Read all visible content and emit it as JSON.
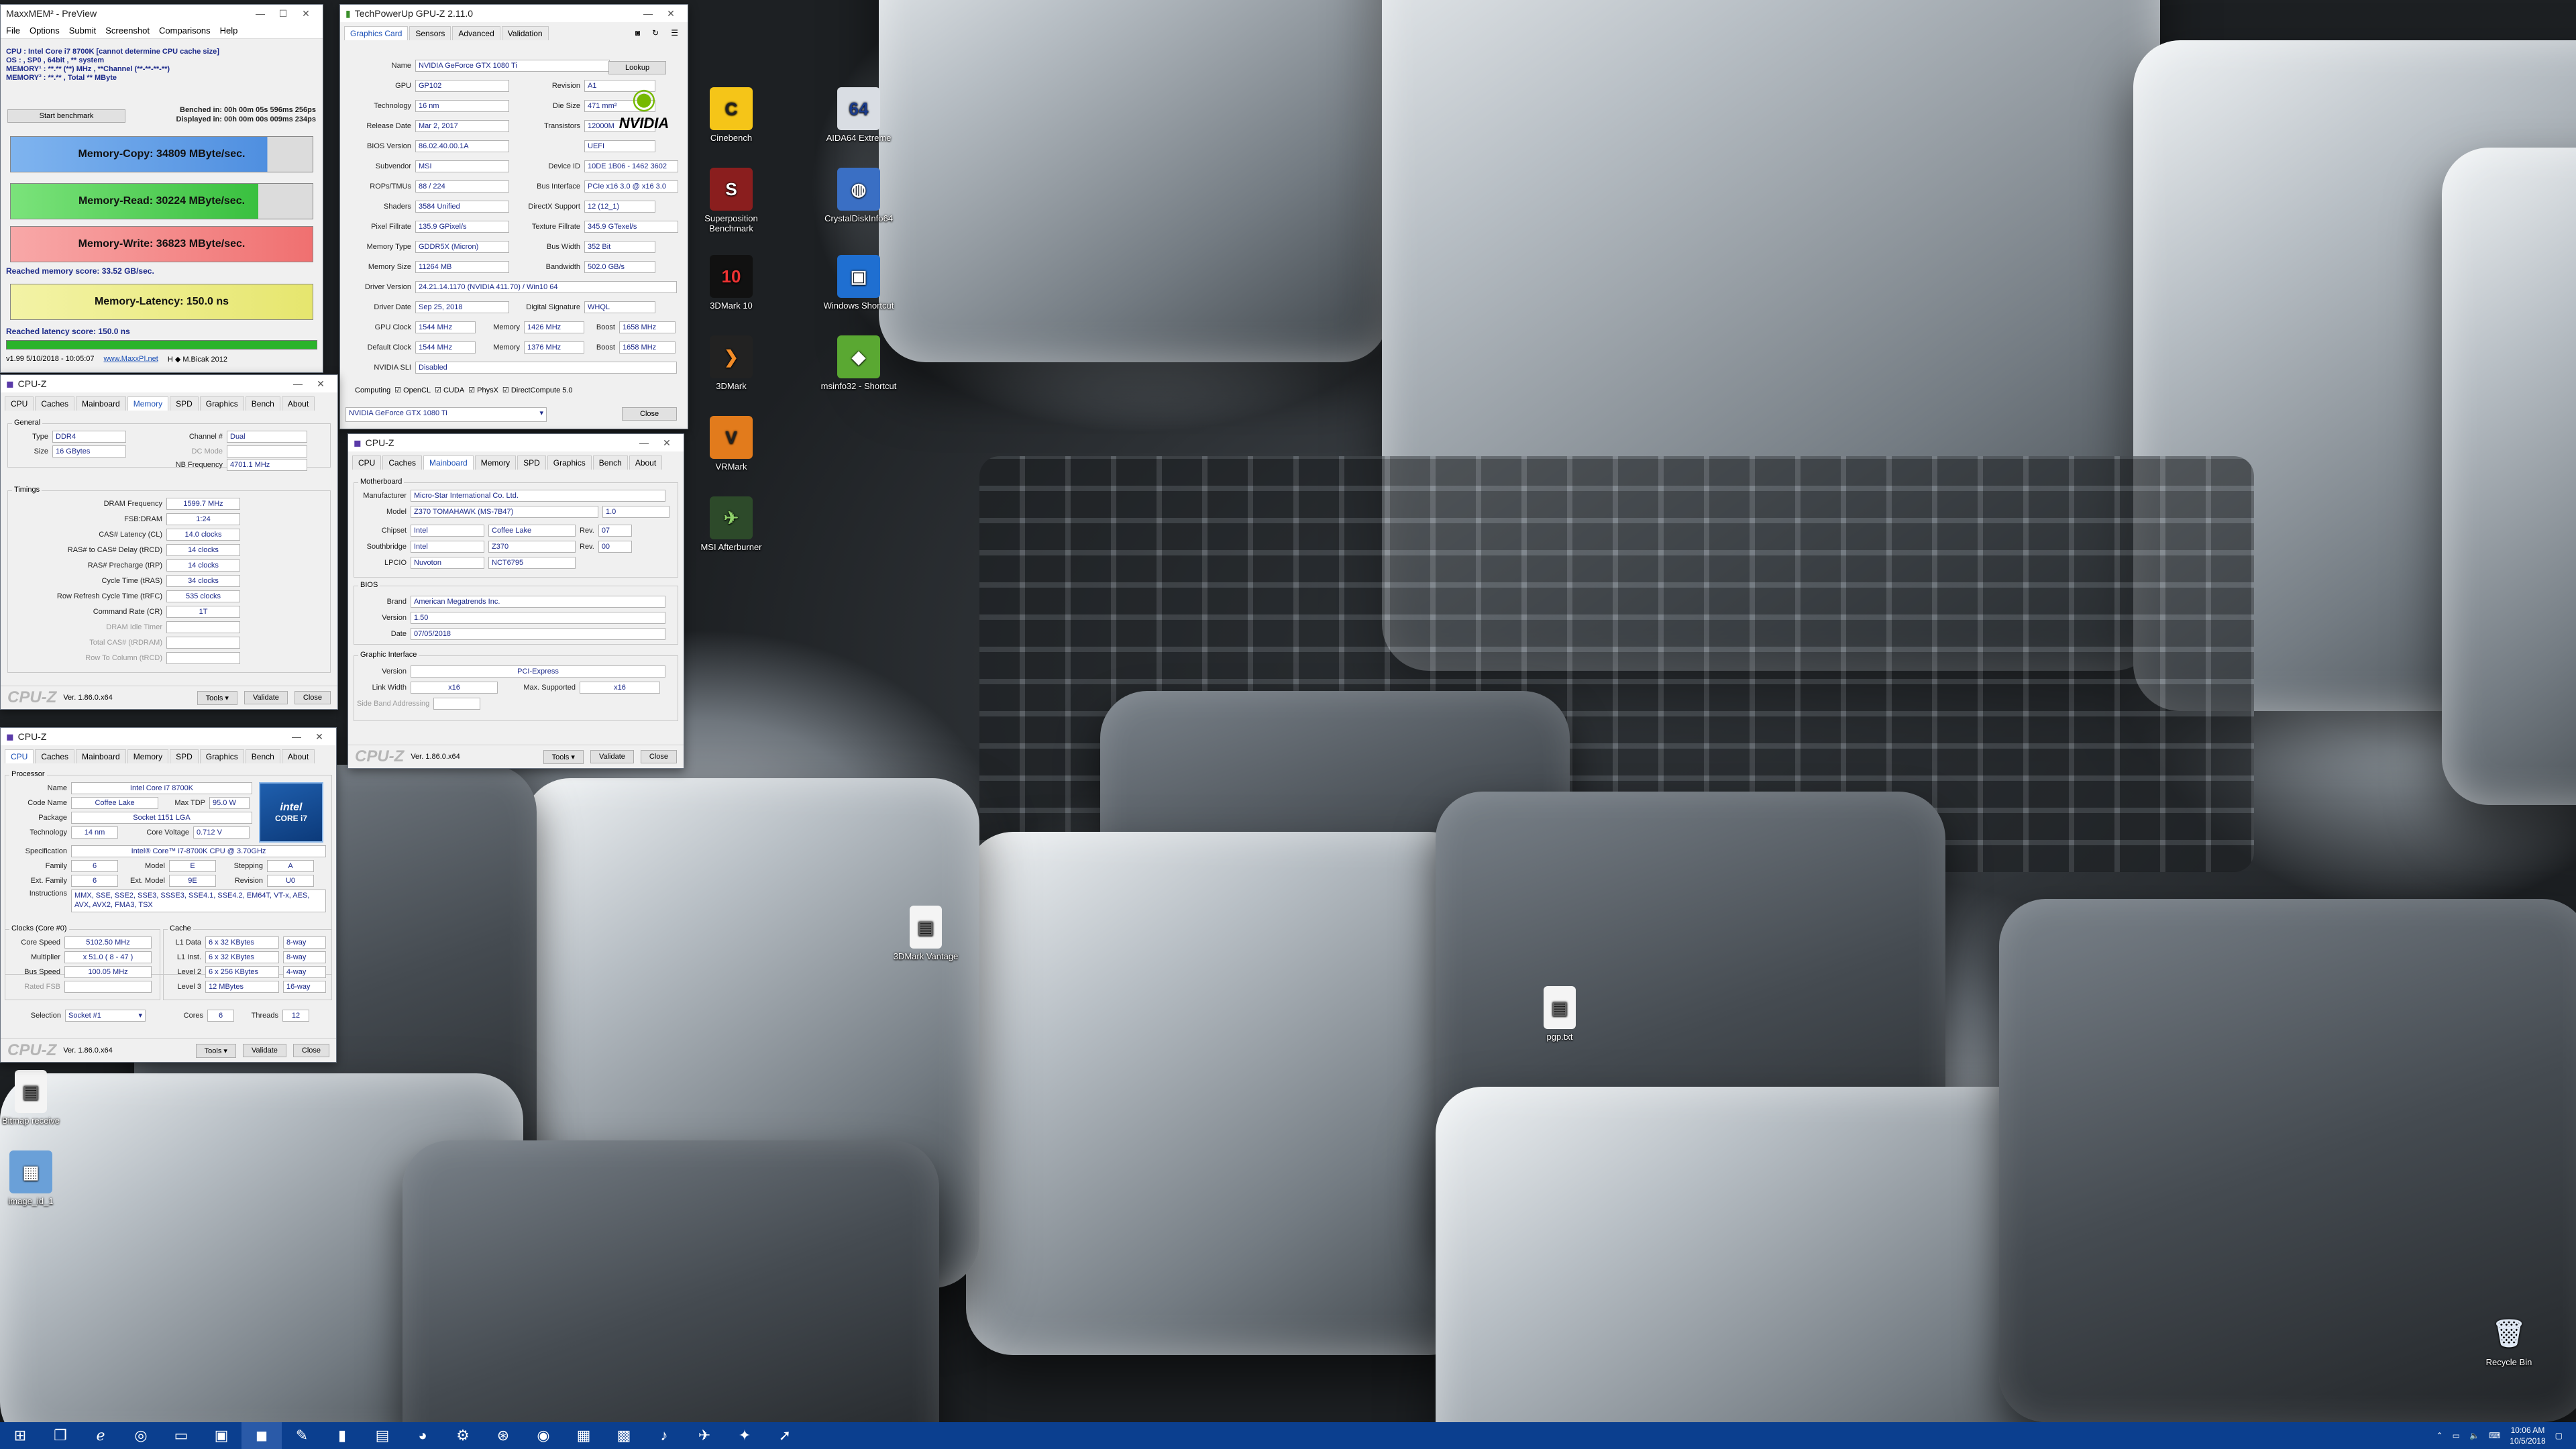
{
  "maxxmem": {
    "title": "MaxxMEM² - PreView",
    "menu": [
      "File",
      "Options",
      "Submit",
      "Screenshot",
      "Comparisons",
      "Help"
    ],
    "cpu_line": "CPU : Intel Core i7 8700K  [cannot determine CPU cache size]",
    "os_line": "OS : , SP0 , 64bit , ** system",
    "mem1_line": "MEMORY¹ : **.** (**) MHz , **Channel (**-**-**-**)",
    "mem2_line": "MEMORY² : **.** , Total ** MByte",
    "start_button": "Start benchmark",
    "benched": "Benched in: 00h 00m 05s 596ms 256ps",
    "displayed": "Displayed in: 00h 00m 00s 009ms 234ps",
    "copy": "Memory-Copy: 34809 MByte/sec.",
    "read": "Memory-Read: 30224 MByte/sec.",
    "write": "Memory-Write: 36823 MByte/sec.",
    "score": "Reached memory score: 33.52 GB/sec.",
    "latency": "Memory-Latency: 150.0 ns",
    "latency_score": "Reached latency score: 150.0 ns",
    "version": "v1.99   5/10/2018 - 10:05:07",
    "site": "www.MaxxPI.net",
    "author": "H  ◆ M.Bicak 2012"
  },
  "gpuz": {
    "title": "TechPowerUp GPU-Z 2.11.0",
    "tabs": [
      "Graphics Card",
      "Sensors",
      "Advanced",
      "Validation"
    ],
    "lookup": "Lookup",
    "rows": [
      {
        "label": "Name",
        "value": "NVIDIA GeForce GTX 1080 Ti"
      },
      {
        "label": "GPU",
        "value": "GP102",
        "label2": "Revision",
        "value2": "A1"
      },
      {
        "label": "Technology",
        "value": "16 nm",
        "label2": "Die Size",
        "value2": "471 mm²"
      },
      {
        "label": "Release Date",
        "value": "Mar 2, 2017",
        "label2": "Transistors",
        "value2": "12000M"
      },
      {
        "label": "BIOS Version",
        "value": "86.02.40.00.1A",
        "label2": "",
        "value2": "UEFI"
      },
      {
        "label": "Subvendor",
        "value": "MSI",
        "label2": "Device ID",
        "value2": "10DE 1B06 - 1462 3602"
      },
      {
        "label": "ROPs/TMUs",
        "value": "88 / 224",
        "label2": "Bus Interface",
        "value2": "PCIe x16 3.0 @ x16 3.0"
      },
      {
        "label": "Shaders",
        "value": "3584 Unified",
        "label2": "DirectX Support",
        "value2": "12 (12_1)"
      },
      {
        "label": "Pixel Fillrate",
        "value": "135.9 GPixel/s",
        "label2": "Texture Fillrate",
        "value2": "345.9 GTexel/s"
      },
      {
        "label": "Memory Type",
        "value": "GDDR5X (Micron)",
        "label2": "Bus Width",
        "value2": "352 Bit"
      },
      {
        "label": "Memory Size",
        "value": "11264 MB",
        "label2": "Bandwidth",
        "value2": "502.0 GB/s"
      },
      {
        "label": "Driver Version",
        "value": "24.21.14.1170 (NVIDIA 411.70) / Win10 64"
      },
      {
        "label": "Driver Date",
        "value": "Sep 25, 2018",
        "label2": "Digital Signature",
        "value2": "WHQL"
      },
      {
        "label": "GPU Clock",
        "value": "1544 MHz",
        "label2": "Memory",
        "value2": "1426 MHz",
        "label3": "Boost",
        "value3": "1658 MHz"
      },
      {
        "label": "Default Clock",
        "value": "1544 MHz",
        "label2": "Memory",
        "value2": "1376 MHz",
        "label3": "Boost",
        "value3": "1658 MHz"
      },
      {
        "label": "NVIDIA SLI",
        "value": "Disabled"
      }
    ],
    "computing_label": "Computing",
    "computing": [
      "OpenCL",
      "CUDA",
      "PhysX",
      "DirectCompute 5.0"
    ],
    "select": "NVIDIA GeForce GTX 1080 Ti",
    "close": "Close",
    "brand": "NVIDIA"
  },
  "cpuz_mem": {
    "title": "CPU-Z",
    "tabs": [
      "CPU",
      "Caches",
      "Mainboard",
      "Memory",
      "SPD",
      "Graphics",
      "Bench",
      "About"
    ],
    "general": "General",
    "type_label": "Type",
    "type": "DDR4",
    "channel_label": "Channel #",
    "channel": "Dual",
    "size_label": "Size",
    "size": "16 GBytes",
    "dcmode_label": "DC Mode",
    "nb_label": "NB Frequency",
    "nb": "4701.1 MHz",
    "timings": "Timings",
    "rows": [
      {
        "label": "DRAM Frequency",
        "value": "1599.7 MHz"
      },
      {
        "label": "FSB:DRAM",
        "value": "1:24"
      },
      {
        "label": "CAS# Latency (CL)",
        "value": "14.0 clocks"
      },
      {
        "label": "RAS# to CAS# Delay (tRCD)",
        "value": "14 clocks"
      },
      {
        "label": "RAS# Precharge (tRP)",
        "value": "14 clocks"
      },
      {
        "label": "Cycle Time (tRAS)",
        "value": "34 clocks"
      },
      {
        "label": "Row Refresh Cycle Time (tRFC)",
        "value": "535 clocks"
      },
      {
        "label": "Command Rate (CR)",
        "value": "1T"
      },
      {
        "label": "DRAM Idle Timer",
        "value": ""
      },
      {
        "label": "Total CAS# (tRDRAM)",
        "value": ""
      },
      {
        "label": "Row To Column (tRCD)",
        "value": ""
      }
    ],
    "version": "Ver. 1.86.0.x64",
    "tools": "Tools",
    "validate": "Validate",
    "close": "Close",
    "logo": "CPU-Z"
  },
  "cpuz_mb": {
    "title": "CPU-Z",
    "tabs": [
      "CPU",
      "Caches",
      "Mainboard",
      "Memory",
      "SPD",
      "Graphics",
      "Bench",
      "About"
    ],
    "motherboard": "Motherboard",
    "manufacturer_label": "Manufacturer",
    "manufacturer": "Micro-Star International Co. Ltd.",
    "model_label": "Model",
    "model": "Z370 TOMAHAWK (MS-7B47)",
    "model_rev": "1.0",
    "chipset_label": "Chipset",
    "chipset": "Intel",
    "chipset2": "Coffee Lake",
    "rev_label": "Rev.",
    "chipset_rev": "07",
    "south_label": "Southbridge",
    "south": "Intel",
    "south2": "Z370",
    "south_rev": "00",
    "lpcio_label": "LPCIO",
    "lpcio": "Nuvoton",
    "lpcio2": "NCT6795",
    "bios": "BIOS",
    "brand_label": "Brand",
    "brand": "American Megatrends Inc.",
    "version_label": "Version",
    "bios_version": "1.50",
    "date_label": "Date",
    "bios_date": "07/05/2018",
    "gi": "Graphic Interface",
    "gi_version": "PCI-Express",
    "lw_label": "Link Width",
    "lw": "x16",
    "ms_label": "Max. Supported",
    "ms": "x16",
    "sba_label": "Side Band Addressing",
    "version": "Ver. 1.86.0.x64",
    "tools": "Tools",
    "validate": "Validate",
    "close": "Close",
    "logo": "CPU-Z"
  },
  "cpuz_cpu": {
    "title": "CPU-Z",
    "tabs": [
      "CPU",
      "Caches",
      "Mainboard",
      "Memory",
      "SPD",
      "Graphics",
      "Bench",
      "About"
    ],
    "processor": "Processor",
    "name_label": "Name",
    "name": "Intel Core i7 8700K",
    "code_label": "Code Name",
    "code": "Coffee Lake",
    "tdp_label": "Max TDP",
    "tdp": "95.0 W",
    "pkg_label": "Package",
    "pkg": "Socket 1151 LGA",
    "tech_label": "Technology",
    "tech": "14 nm",
    "volt_label": "Core Voltage",
    "volt": "0.712 V",
    "spec_label": "Specification",
    "spec": "Intel® Core™ i7-8700K CPU @ 3.70GHz",
    "family_label": "Family",
    "family": "6",
    "model_label": "Model",
    "model": "E",
    "step_label": "Stepping",
    "step": "A",
    "extfam_label": "Ext. Family",
    "extfam": "6",
    "extmod_label": "Ext. Model",
    "extmod": "9E",
    "rev_label": "Revision",
    "rev": "U0",
    "instr_label": "Instructions",
    "instr": "MMX, SSE, SSE2, SSE3, SSSE3, SSE4.1, SSE4.2, EM64T, VT-x, AES, AVX, AVX2, FMA3, TSX",
    "clocks": "Clocks (Core #0)",
    "cs_label": "Core Speed",
    "cs": "5102.50 MHz",
    "mult_label": "Multiplier",
    "mult": "x 51.0 ( 8 - 47 )",
    "bus_label": "Bus Speed",
    "bus": "100.05 MHz",
    "fsb_label": "Rated FSB",
    "cache": "Cache",
    "l1d_label": "L1 Data",
    "l1d": "6 x 32 KBytes",
    "l1d_w": "8-way",
    "l1i_label": "L1 Inst.",
    "l1i": "6 x 32 KBytes",
    "l1i_w": "8-way",
    "l2_label": "Level 2",
    "l2": "6 x 256 KBytes",
    "l2_w": "4-way",
    "l3_label": "Level 3",
    "l3": "12 MBytes",
    "l3_w": "16-way",
    "sel_label": "Selection",
    "sel": "Socket #1",
    "cores_label": "Cores",
    "cores": "6",
    "threads_label": "Threads",
    "threads": "12",
    "version": "Ver. 1.86.0.x64",
    "tools": "Tools",
    "validate": "Validate",
    "close": "Close",
    "logo": "CPU-Z",
    "badge": "CORE i7"
  },
  "desktop_icons": [
    "Cinebench",
    "AIDA64 Extreme",
    "Superposition Benchmark",
    "CrystalDiskInfo64",
    "3DMark 10",
    "Windows Shortcut",
    "3DMark",
    "msinfo32 - Shortcut",
    "VRMark",
    "MSI Afterburner",
    "3DMark Vantage",
    "pgp.txt",
    "Bitmap receive",
    "image_id_1",
    "Recycle Bin"
  ],
  "clock": {
    "time": "10:06 AM",
    "date": "10/5/2018"
  }
}
